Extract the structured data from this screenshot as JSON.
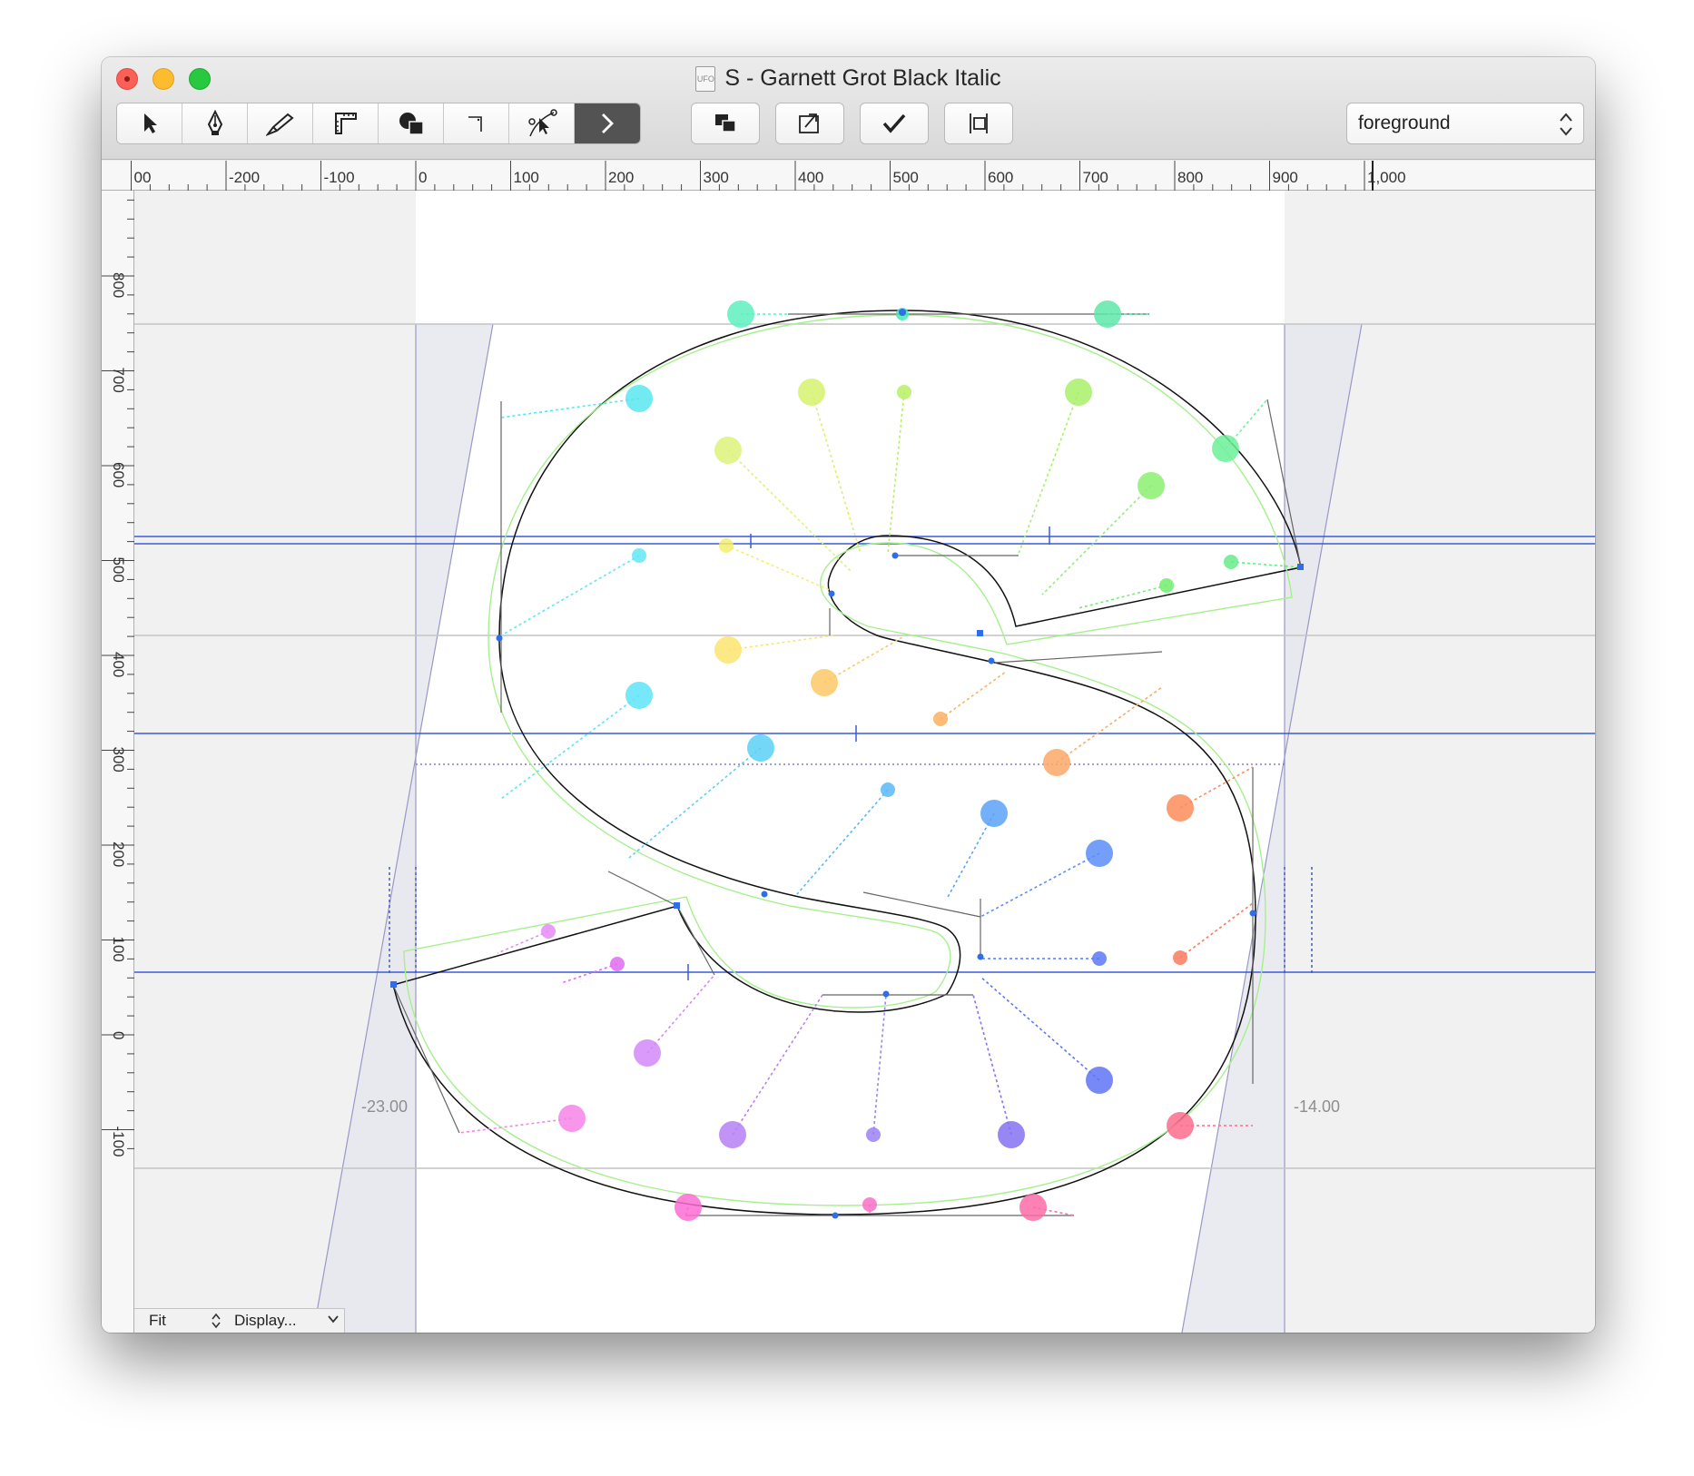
{
  "window": {
    "title": "S - Garnett Grot Black Italic",
    "doc_icon_label": "UFO"
  },
  "toolbar": {
    "tools": [
      {
        "name": "pointer",
        "icon": "arrow-pointer-icon"
      },
      {
        "name": "pen",
        "icon": "pen-nib-icon"
      },
      {
        "name": "knife",
        "icon": "knife-icon"
      },
      {
        "name": "ruler",
        "icon": "ruler-icon"
      },
      {
        "name": "shapes",
        "icon": "shapes-icon"
      },
      {
        "name": "corner",
        "icon": "corner-icon"
      },
      {
        "name": "node-tool",
        "icon": "node-pointer-icon"
      },
      {
        "name": "more",
        "icon": "chevron-right-icon"
      }
    ],
    "layer_popup": "foreground"
  },
  "rulers": {
    "horizontal_labels": [
      "00",
      "-200",
      "-100",
      "0",
      "100",
      "200",
      "300",
      "400",
      "500",
      "600",
      "700",
      "800",
      "900",
      "1,000"
    ],
    "vertical_labels": [
      "800",
      "700",
      "600",
      "500",
      "400",
      "300",
      "200",
      "100",
      "0",
      "-100"
    ]
  },
  "glyph": {
    "name": "S",
    "left_margin": "-23.00",
    "right_margin": "-14.00"
  },
  "bottom_bar": {
    "zoom": "Fit",
    "display_menu": "Display..."
  },
  "colors": {
    "guide_blue": "#3a5ad8",
    "metrics_gray": "#c8c8c8",
    "active_tool": "#535353"
  }
}
